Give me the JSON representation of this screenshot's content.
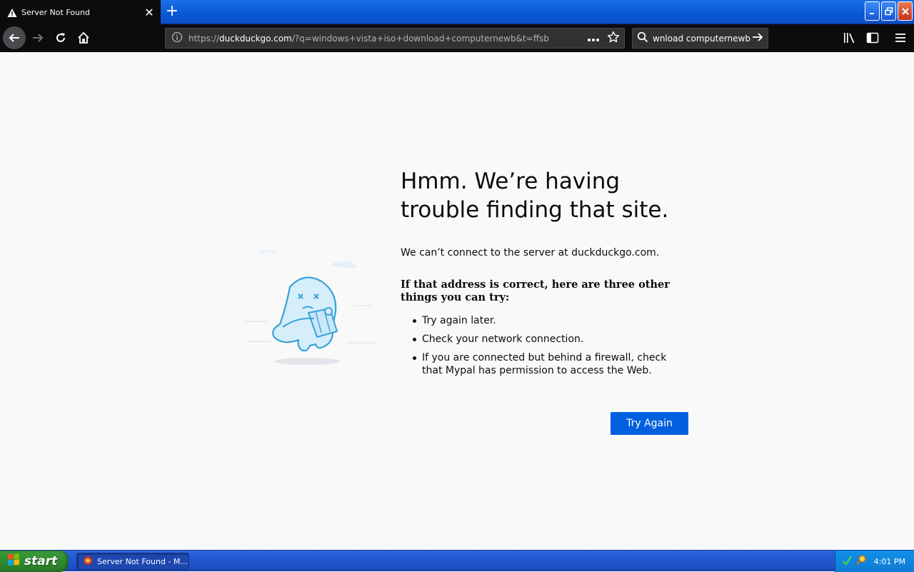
{
  "browser": {
    "tab": {
      "title": "Server Not Found",
      "close_glyph": "✕"
    },
    "new_tab_glyph": "+",
    "url": {
      "scheme": "https://",
      "host": "duckduckgo.com",
      "rest": "/?q=windows+vista+iso+download+computernewb&t=ffsb"
    },
    "search_value": "wnload computernewb"
  },
  "error": {
    "title": "Hmm. We’re having trouble finding that site.",
    "description": "We can’t connect to the server at duckduckgo.com.",
    "try_heading": "If that address is correct, here are three other things you can try:",
    "suggestions": [
      "Try again later.",
      "Check your network connection.",
      "If you are connected but behind a firewall, check that Mypal has permission to access the Web."
    ],
    "button_label": "Try Again"
  },
  "taskbar": {
    "start_label": "start",
    "task_label": "Server Not Found - M...",
    "clock": "4:01 PM"
  },
  "colors": {
    "accent": "#0060df",
    "xp_blue": "#245edb",
    "xp_green": "#2f8a2f",
    "toolbar_dark": "#0c0c0d"
  }
}
